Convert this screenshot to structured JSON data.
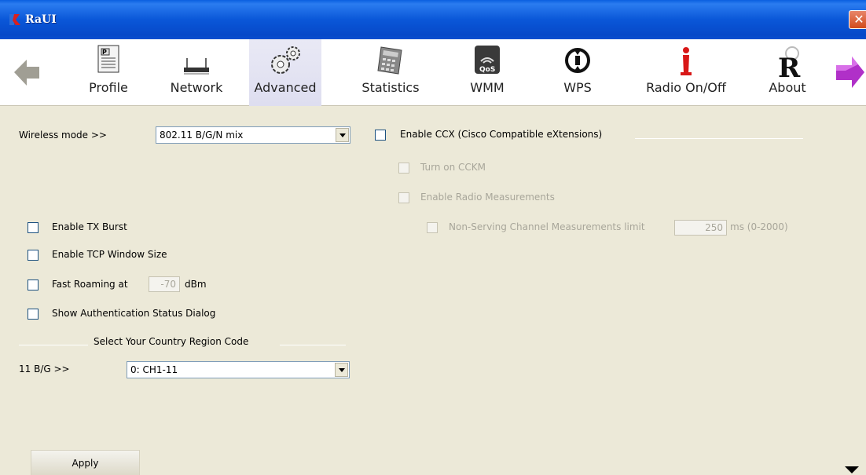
{
  "window": {
    "title": "RaUI",
    "close_glyph": "✕"
  },
  "toolbar": {
    "back_icon": "left-arrow-icon",
    "forward_icon": "right-arrow-icon",
    "items": [
      {
        "label": "Profile",
        "icon": "profile-icon"
      },
      {
        "label": "Network",
        "icon": "network-icon"
      },
      {
        "label": "Advanced",
        "icon": "gears-icon",
        "selected": true
      },
      {
        "label": "Statistics",
        "icon": "calculator-icon"
      },
      {
        "label": "WMM",
        "icon": "qos-icon",
        "badge": "QoS"
      },
      {
        "label": "WPS",
        "icon": "wps-icon"
      },
      {
        "label": "Radio On/Off",
        "icon": "radio-icon"
      },
      {
        "label": "About",
        "icon": "about-icon",
        "mark": "R"
      }
    ]
  },
  "advanced": {
    "wireless_mode_label": "Wireless mode >>",
    "wireless_mode_value": "802.11 B/G/N mix",
    "tx_burst": "Enable TX Burst",
    "tcp_window": "Enable TCP Window Size",
    "fast_roaming": "Fast Roaming at",
    "fast_roaming_value": "-70",
    "fast_roaming_unit": "dBm",
    "show_auth": "Show Authentication Status Dialog",
    "country_region_title": "Select Your Country Region Code",
    "band_label": "11 B/G >>",
    "band_value": "0: CH1-11",
    "ccx": {
      "enable": "Enable CCX (Cisco Compatible eXtensions)",
      "cckm": "Turn on CCKM",
      "radio_measurements": "Enable Radio Measurements",
      "non_serving": "Non-Serving Channel Measurements limit",
      "non_serving_value": "250",
      "non_serving_unit": "ms (0-2000)"
    },
    "apply": "Apply"
  },
  "colors": {
    "titlebar": "#0a57d8",
    "background": "#ece9d8",
    "accent_red": "#d81818",
    "accent_purple": "#b030c8"
  }
}
